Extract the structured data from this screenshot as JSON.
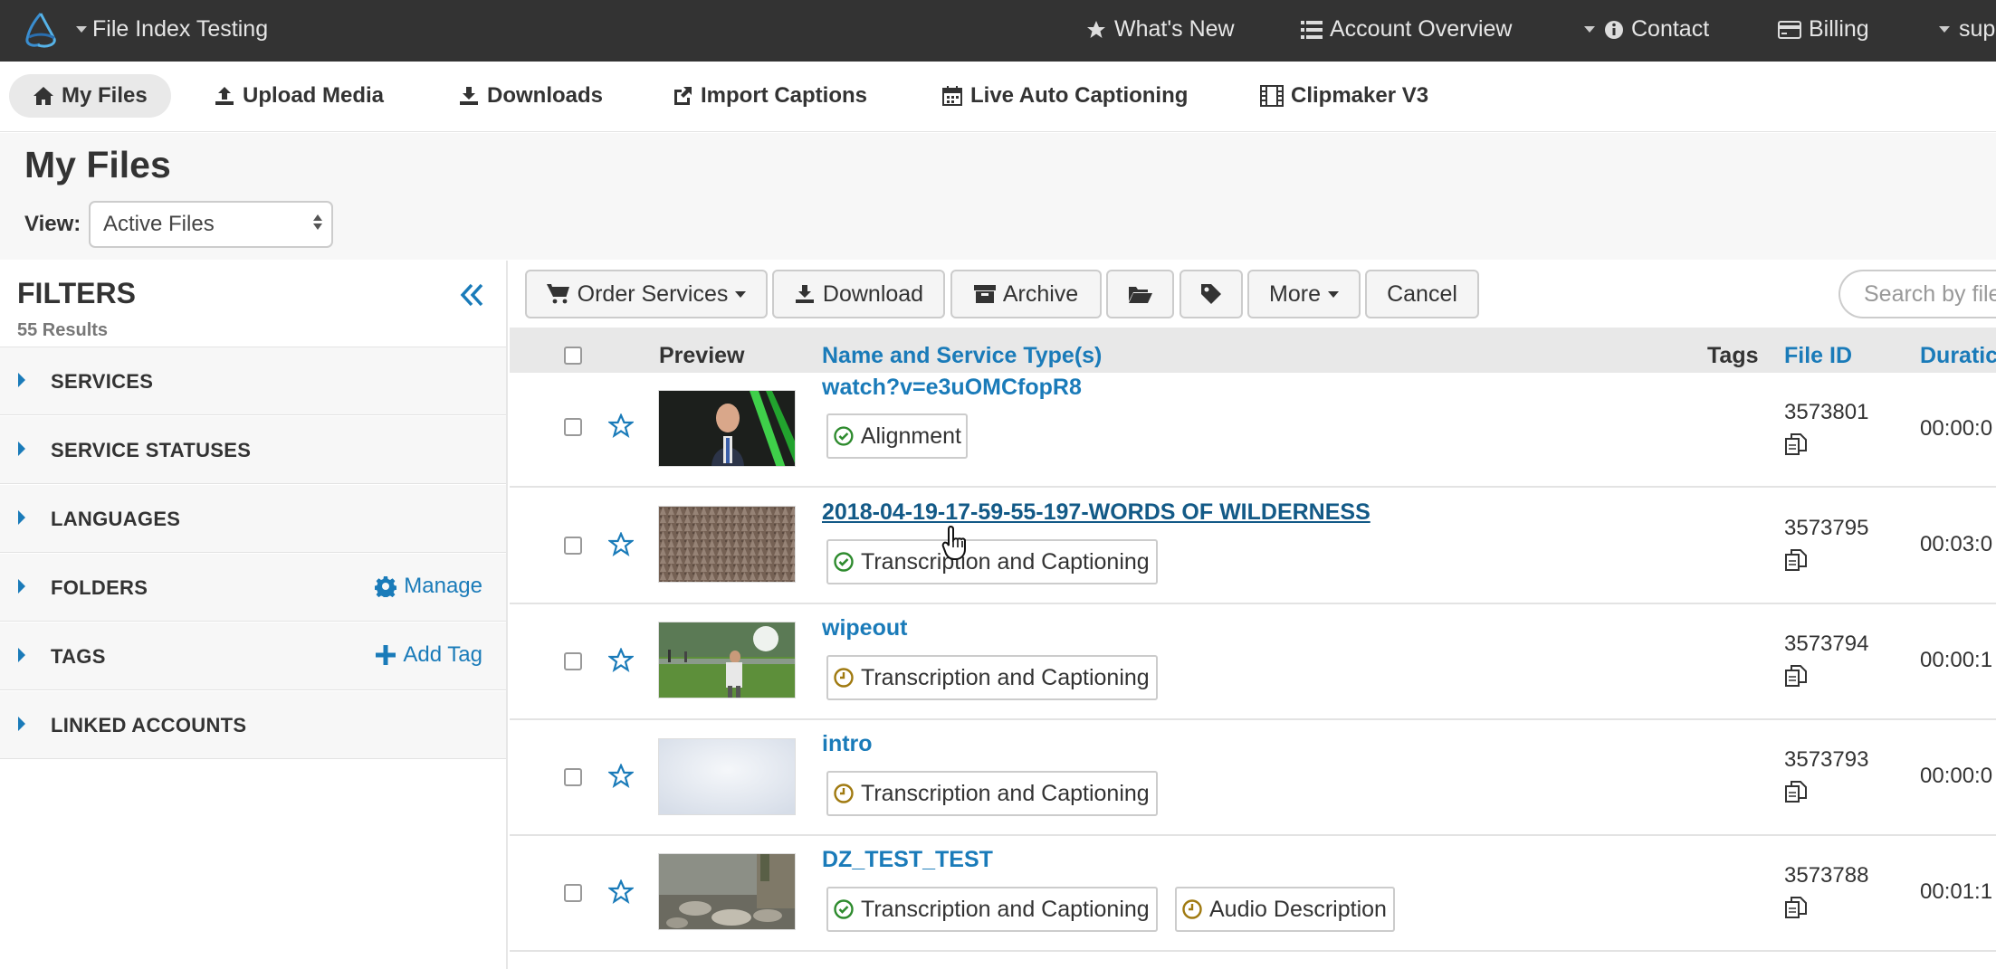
{
  "topnav": {
    "brand": "File Index Testing",
    "whats_new": "What's New",
    "account_overview": "Account Overview",
    "contact": "Contact",
    "billing": "Billing",
    "user": "sup"
  },
  "subnav": {
    "my_files": "My Files",
    "upload_media": "Upload Media",
    "downloads": "Downloads",
    "import_captions": "Import Captions",
    "live_auto_captioning": "Live Auto Captioning",
    "clipmaker": "Clipmaker V3"
  },
  "page": {
    "title": "My Files",
    "view_label": "View:",
    "view_value": "Active Files"
  },
  "filters": {
    "title": "FILTERS",
    "count": "55 Results",
    "items": [
      {
        "label": "SERVICES",
        "action": ""
      },
      {
        "label": "SERVICE STATUSES",
        "action": ""
      },
      {
        "label": "LANGUAGES",
        "action": ""
      },
      {
        "label": "FOLDERS",
        "action": "Manage"
      },
      {
        "label": "TAGS",
        "action": "Add Tag"
      },
      {
        "label": "LINKED ACCOUNTS",
        "action": ""
      }
    ]
  },
  "toolbar": {
    "order_services": "Order Services",
    "download": "Download",
    "archive": "Archive",
    "more": "More",
    "cancel": "Cancel",
    "search_placeholder": "Search by file"
  },
  "table": {
    "headers": {
      "preview": "Preview",
      "name": "Name and Service Type(s)",
      "tags": "Tags",
      "file_id": "File ID",
      "duration": "Duratic"
    },
    "rows": [
      {
        "name": "watch?v=e3uOMCfopR8",
        "file_id": "3573801",
        "duration": "00:00:0",
        "services": [
          {
            "label": "Alignment",
            "status": "complete"
          }
        ]
      },
      {
        "name": "2018-04-19-17-59-55-197-WORDS OF WILDERNESS",
        "file_id": "3573795",
        "duration": "00:03:0",
        "services": [
          {
            "label": "Transcription and Captioning",
            "status": "complete"
          }
        ]
      },
      {
        "name": "wipeout",
        "file_id": "3573794",
        "duration": "00:00:1",
        "services": [
          {
            "label": "Transcription and Captioning",
            "status": "pending"
          }
        ]
      },
      {
        "name": "intro",
        "file_id": "3573793",
        "duration": "00:00:0",
        "services": [
          {
            "label": "Transcription and Captioning",
            "status": "pending"
          }
        ]
      },
      {
        "name": "DZ_TEST_TEST",
        "file_id": "3573788",
        "duration": "00:01:1",
        "services": [
          {
            "label": "Transcription and Captioning",
            "status": "complete"
          },
          {
            "label": "Audio Description",
            "status": "pending"
          }
        ]
      }
    ]
  },
  "colors": {
    "topbar": "#333333",
    "link": "#1a7bb9",
    "status_complete": "#2e8b2e",
    "status_pending": "#a07a10"
  }
}
